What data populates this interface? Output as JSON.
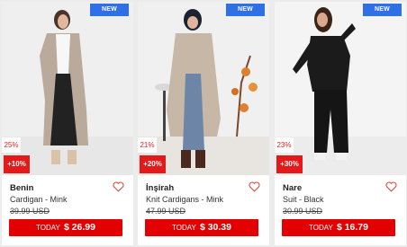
{
  "products": [
    {
      "badge_new": "NEW",
      "discount_pct": "25%",
      "extra_discount": "+10%",
      "name": "Benin",
      "subtitle": "Cardigan - Mink",
      "old_price": "39.99 USD",
      "today_label": "TODAY",
      "price": "$ 26.99"
    },
    {
      "badge_new": "NEW",
      "discount_pct": "21%",
      "extra_discount": "+20%",
      "name": "İnşirah",
      "subtitle": "Knit Cardigans - Mink",
      "old_price": "47.99 USD",
      "today_label": "TODAY",
      "price": "$ 30.39"
    },
    {
      "badge_new": "NEW",
      "discount_pct": "23%",
      "extra_discount": "+30%",
      "name": "Nare",
      "subtitle": "Suit - Black",
      "old_price": "30.99 USD",
      "today_label": "TODAY",
      "price": "$ 16.79"
    }
  ],
  "colors": {
    "accent_red": "#e30000",
    "new_badge_blue": "#2f70e6"
  }
}
